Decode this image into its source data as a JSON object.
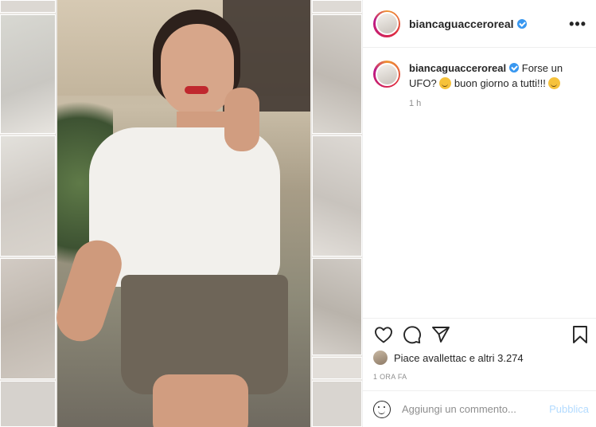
{
  "post": {
    "username": "biancaguacceroreal",
    "caption_user": "biancaguacceroreal",
    "caption_text_1": "Forse un UFO?",
    "caption_text_2": "buon giorno a tutti!!!",
    "caption_time": "1 h",
    "likes_prefix": "Piace a ",
    "likes_user": "vallettac",
    "likes_middle": " e ",
    "likes_others": "altri 3.274",
    "post_date": "1 ORA FA",
    "more_label": "•••"
  },
  "comment": {
    "placeholder": "Aggiungi un commento...",
    "publish_label": "Pubblica"
  },
  "icons": {
    "verified": "verified-badge-icon",
    "like": "heart-icon",
    "comment": "comment-bubble-icon",
    "share": "paper-plane-icon",
    "save": "bookmark-icon",
    "emoji": "smiley-icon"
  },
  "colors": {
    "verified": "#3897f0",
    "publish_disabled": "#b3dbff",
    "meta_text": "#8e8e8e"
  }
}
